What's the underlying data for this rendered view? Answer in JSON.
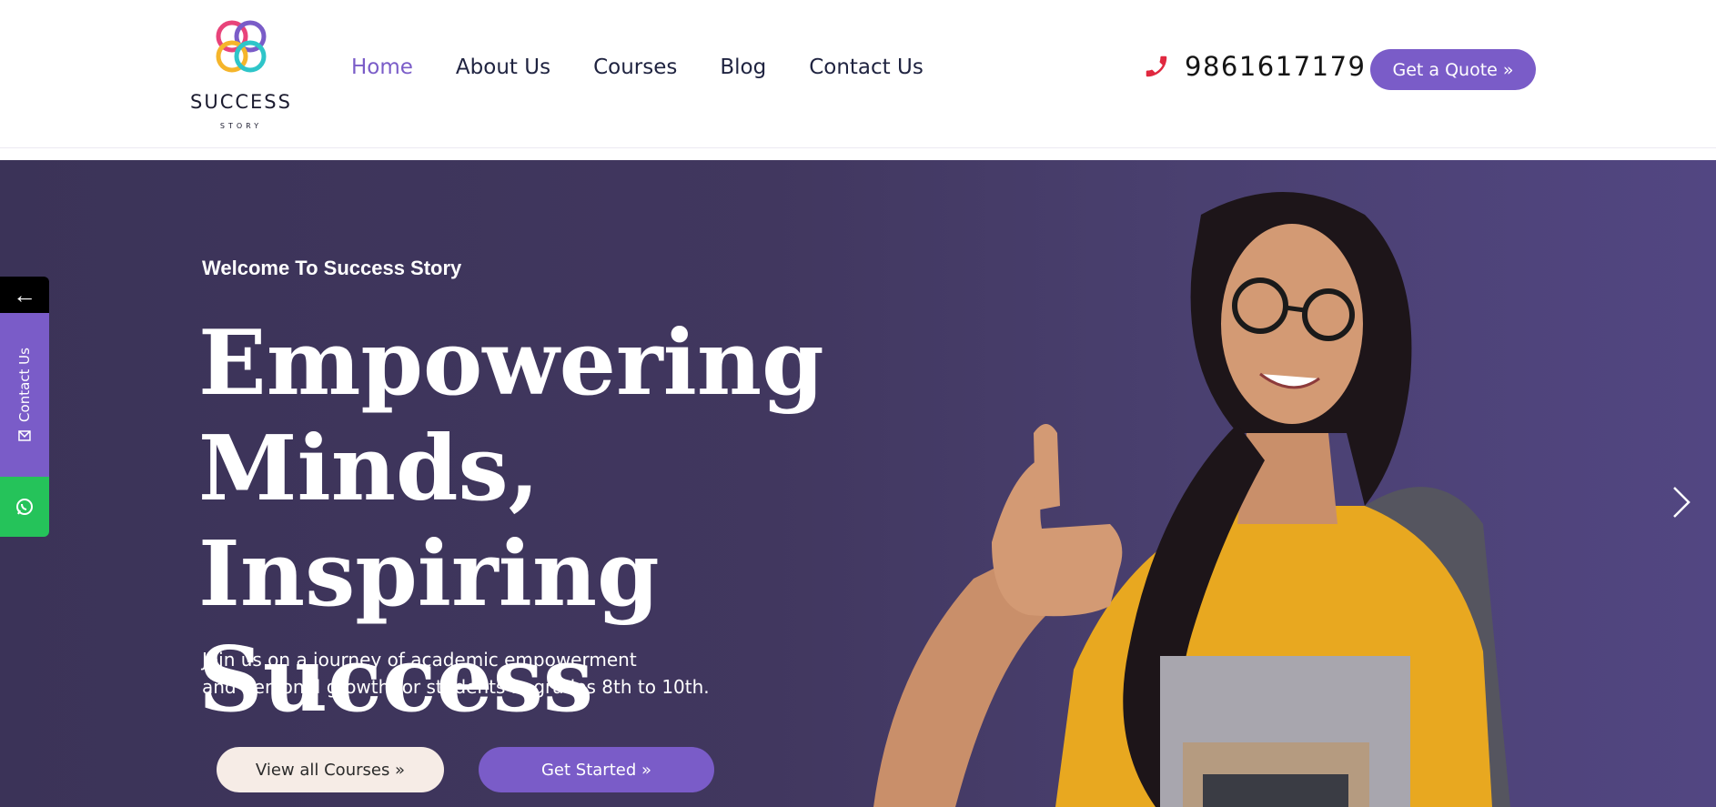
{
  "brand": {
    "name": "SUCCESS",
    "tagline": "STORY",
    "logo_icon": "interlocking-rings-logo",
    "colors": {
      "accent": "#7a5cc8",
      "rings": [
        "#e8437a",
        "#f5b52b",
        "#2ec5c9",
        "#7a5cc8"
      ]
    }
  },
  "nav": {
    "items": [
      {
        "label": "Home",
        "active": true
      },
      {
        "label": "About Us",
        "active": false
      },
      {
        "label": "Courses",
        "active": false
      },
      {
        "label": "Blog",
        "active": false
      },
      {
        "label": "Contact Us",
        "active": false
      }
    ]
  },
  "contact": {
    "phone_icon": "phone-icon",
    "phone": "9861617179",
    "quote_button": "Get a Quote »"
  },
  "hero": {
    "welcome": "Welcome To Success Story",
    "headline_lines": [
      "Empowering",
      "Minds, Inspiring",
      "Success"
    ],
    "subtext_lines": [
      "Join us on a journey of academic empowerment",
      "and personal growth for students in grades 8th to 10th."
    ],
    "buttons": {
      "courses": "View all Courses »",
      "start": "Get Started »"
    },
    "next_icon": "chevron-right-icon"
  },
  "side_widget": {
    "back_icon": "arrow-left-icon",
    "back_glyph": "←",
    "contact_label": "Contact Us",
    "contact_icon": "mail-icon",
    "whatsapp_icon": "whatsapp-icon",
    "colors": {
      "back": "#000000",
      "contact": "#7a5cc8",
      "whatsapp": "#25c35a"
    }
  }
}
